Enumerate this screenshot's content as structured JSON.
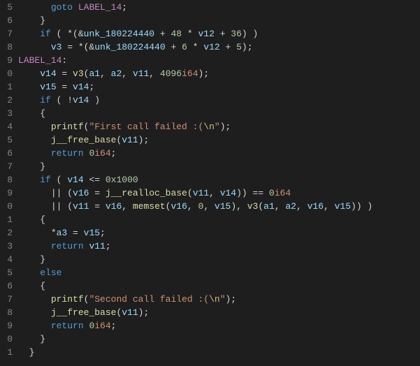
{
  "line_numbers": [
    "5",
    "6",
    "7",
    "8",
    "9",
    "0",
    "1",
    "2",
    "3",
    "4",
    "5",
    "6",
    "7",
    "8",
    "9",
    "0",
    "1",
    "2",
    "3",
    "4",
    "5",
    "6",
    "7",
    "8",
    "9",
    "0",
    "1"
  ],
  "lines": [
    {
      "indent": 3,
      "tokens": [
        {
          "t": "goto",
          "c": "kw"
        },
        {
          "t": " ",
          "c": "op"
        },
        {
          "t": "LABEL_14",
          "c": "label"
        },
        {
          "t": ";",
          "c": "punct"
        }
      ]
    },
    {
      "indent": 2,
      "tokens": [
        {
          "t": "}",
          "c": "punct"
        }
      ]
    },
    {
      "indent": 2,
      "tokens": [
        {
          "t": "if",
          "c": "kw"
        },
        {
          "t": " ( *(&",
          "c": "punct"
        },
        {
          "t": "unk_180224440",
          "c": "id"
        },
        {
          "t": " + ",
          "c": "op"
        },
        {
          "t": "48",
          "c": "num"
        },
        {
          "t": " * ",
          "c": "op"
        },
        {
          "t": "v12",
          "c": "id"
        },
        {
          "t": " + ",
          "c": "op"
        },
        {
          "t": "36",
          "c": "num"
        },
        {
          "t": ") )",
          "c": "punct"
        }
      ]
    },
    {
      "indent": 3,
      "tokens": [
        {
          "t": "v3",
          "c": "id"
        },
        {
          "t": " = *(&",
          "c": "punct"
        },
        {
          "t": "unk_180224440",
          "c": "id"
        },
        {
          "t": " + ",
          "c": "op"
        },
        {
          "t": "6",
          "c": "num"
        },
        {
          "t": " * ",
          "c": "op"
        },
        {
          "t": "v12",
          "c": "id"
        },
        {
          "t": " + ",
          "c": "op"
        },
        {
          "t": "5",
          "c": "num"
        },
        {
          "t": ");",
          "c": "punct"
        }
      ]
    },
    {
      "indent": 0,
      "tokens": [
        {
          "t": "LABEL_14",
          "c": "label"
        },
        {
          "t": ":",
          "c": "punct"
        }
      ]
    },
    {
      "indent": 2,
      "tokens": [
        {
          "t": "v14",
          "c": "id"
        },
        {
          "t": " = ",
          "c": "op"
        },
        {
          "t": "v3",
          "c": "func"
        },
        {
          "t": "(",
          "c": "punct"
        },
        {
          "t": "a1",
          "c": "id"
        },
        {
          "t": ", ",
          "c": "punct"
        },
        {
          "t": "a2",
          "c": "id"
        },
        {
          "t": ", ",
          "c": "punct"
        },
        {
          "t": "v11",
          "c": "id"
        },
        {
          "t": ", ",
          "c": "punct"
        },
        {
          "t": "4096",
          "c": "num"
        },
        {
          "t": "i64",
          "c": "pref"
        },
        {
          "t": ");",
          "c": "punct"
        }
      ]
    },
    {
      "indent": 2,
      "tokens": [
        {
          "t": "v15",
          "c": "id"
        },
        {
          "t": " = ",
          "c": "op"
        },
        {
          "t": "v14",
          "c": "id"
        },
        {
          "t": ";",
          "c": "punct"
        }
      ]
    },
    {
      "indent": 2,
      "tokens": [
        {
          "t": "if",
          "c": "kw"
        },
        {
          "t": " ( !",
          "c": "punct"
        },
        {
          "t": "v14",
          "c": "id"
        },
        {
          "t": " )",
          "c": "punct"
        }
      ]
    },
    {
      "indent": 2,
      "tokens": [
        {
          "t": "{",
          "c": "punct"
        }
      ]
    },
    {
      "indent": 3,
      "tokens": [
        {
          "t": "printf",
          "c": "func"
        },
        {
          "t": "(",
          "c": "punct"
        },
        {
          "t": "\"First call failed :(",
          "c": "str"
        },
        {
          "t": "\\n",
          "c": "esc"
        },
        {
          "t": "\"",
          "c": "str"
        },
        {
          "t": ");",
          "c": "punct"
        }
      ]
    },
    {
      "indent": 3,
      "tokens": [
        {
          "t": "j__free_base",
          "c": "func"
        },
        {
          "t": "(",
          "c": "punct"
        },
        {
          "t": "v11",
          "c": "id"
        },
        {
          "t": ");",
          "c": "punct"
        }
      ]
    },
    {
      "indent": 3,
      "tokens": [
        {
          "t": "return",
          "c": "kw"
        },
        {
          "t": " ",
          "c": "op"
        },
        {
          "t": "0",
          "c": "num"
        },
        {
          "t": "i64",
          "c": "pref"
        },
        {
          "t": ";",
          "c": "punct"
        }
      ]
    },
    {
      "indent": 2,
      "tokens": [
        {
          "t": "}",
          "c": "punct"
        }
      ]
    },
    {
      "indent": 2,
      "tokens": [
        {
          "t": "if",
          "c": "kw"
        },
        {
          "t": " ( ",
          "c": "punct"
        },
        {
          "t": "v14",
          "c": "id"
        },
        {
          "t": " <= ",
          "c": "op"
        },
        {
          "t": "0x1000",
          "c": "num"
        }
      ]
    },
    {
      "indent": 3,
      "tokens": [
        {
          "t": "|| (",
          "c": "punct"
        },
        {
          "t": "v16",
          "c": "id"
        },
        {
          "t": " = ",
          "c": "op"
        },
        {
          "t": "j__realloc_base",
          "c": "func"
        },
        {
          "t": "(",
          "c": "punct"
        },
        {
          "t": "v11",
          "c": "id"
        },
        {
          "t": ", ",
          "c": "punct"
        },
        {
          "t": "v14",
          "c": "id"
        },
        {
          "t": ")) == ",
          "c": "punct"
        },
        {
          "t": "0",
          "c": "num"
        },
        {
          "t": "i64",
          "c": "pref"
        }
      ]
    },
    {
      "indent": 3,
      "tokens": [
        {
          "t": "|| (",
          "c": "punct"
        },
        {
          "t": "v11",
          "c": "id"
        },
        {
          "t": " = ",
          "c": "op"
        },
        {
          "t": "v16",
          "c": "id"
        },
        {
          "t": ", ",
          "c": "punct"
        },
        {
          "t": "memset",
          "c": "func"
        },
        {
          "t": "(",
          "c": "punct"
        },
        {
          "t": "v16",
          "c": "id"
        },
        {
          "t": ", ",
          "c": "punct"
        },
        {
          "t": "0",
          "c": "num"
        },
        {
          "t": ", ",
          "c": "punct"
        },
        {
          "t": "v15",
          "c": "id"
        },
        {
          "t": "), ",
          "c": "punct"
        },
        {
          "t": "v3",
          "c": "func"
        },
        {
          "t": "(",
          "c": "punct"
        },
        {
          "t": "a1",
          "c": "id"
        },
        {
          "t": ", ",
          "c": "punct"
        },
        {
          "t": "a2",
          "c": "id"
        },
        {
          "t": ", ",
          "c": "punct"
        },
        {
          "t": "v16",
          "c": "id"
        },
        {
          "t": ", ",
          "c": "punct"
        },
        {
          "t": "v15",
          "c": "id"
        },
        {
          "t": ")) )",
          "c": "punct"
        }
      ]
    },
    {
      "indent": 2,
      "tokens": [
        {
          "t": "{",
          "c": "punct"
        }
      ]
    },
    {
      "indent": 3,
      "tokens": [
        {
          "t": "*",
          "c": "punct"
        },
        {
          "t": "a3",
          "c": "id"
        },
        {
          "t": " = ",
          "c": "op"
        },
        {
          "t": "v15",
          "c": "id"
        },
        {
          "t": ";",
          "c": "punct"
        }
      ]
    },
    {
      "indent": 3,
      "tokens": [
        {
          "t": "return",
          "c": "kw"
        },
        {
          "t": " ",
          "c": "op"
        },
        {
          "t": "v11",
          "c": "id"
        },
        {
          "t": ";",
          "c": "punct"
        }
      ]
    },
    {
      "indent": 2,
      "tokens": [
        {
          "t": "}",
          "c": "punct"
        }
      ]
    },
    {
      "indent": 2,
      "tokens": [
        {
          "t": "else",
          "c": "kw"
        }
      ]
    },
    {
      "indent": 2,
      "tokens": [
        {
          "t": "{",
          "c": "punct"
        }
      ]
    },
    {
      "indent": 3,
      "tokens": [
        {
          "t": "printf",
          "c": "func"
        },
        {
          "t": "(",
          "c": "punct"
        },
        {
          "t": "\"Second call failed :(",
          "c": "str"
        },
        {
          "t": "\\n",
          "c": "esc"
        },
        {
          "t": "\"",
          "c": "str"
        },
        {
          "t": ");",
          "c": "punct"
        }
      ]
    },
    {
      "indent": 3,
      "tokens": [
        {
          "t": "j__free_base",
          "c": "func"
        },
        {
          "t": "(",
          "c": "punct"
        },
        {
          "t": "v11",
          "c": "id"
        },
        {
          "t": ");",
          "c": "punct"
        }
      ]
    },
    {
      "indent": 3,
      "tokens": [
        {
          "t": "return",
          "c": "kw"
        },
        {
          "t": " ",
          "c": "op"
        },
        {
          "t": "0",
          "c": "num"
        },
        {
          "t": "i64",
          "c": "pref"
        },
        {
          "t": ";",
          "c": "punct"
        }
      ]
    },
    {
      "indent": 2,
      "tokens": [
        {
          "t": "}",
          "c": "punct"
        }
      ]
    },
    {
      "indent": 1,
      "tokens": [
        {
          "t": "}",
          "c": "punct"
        }
      ]
    }
  ]
}
